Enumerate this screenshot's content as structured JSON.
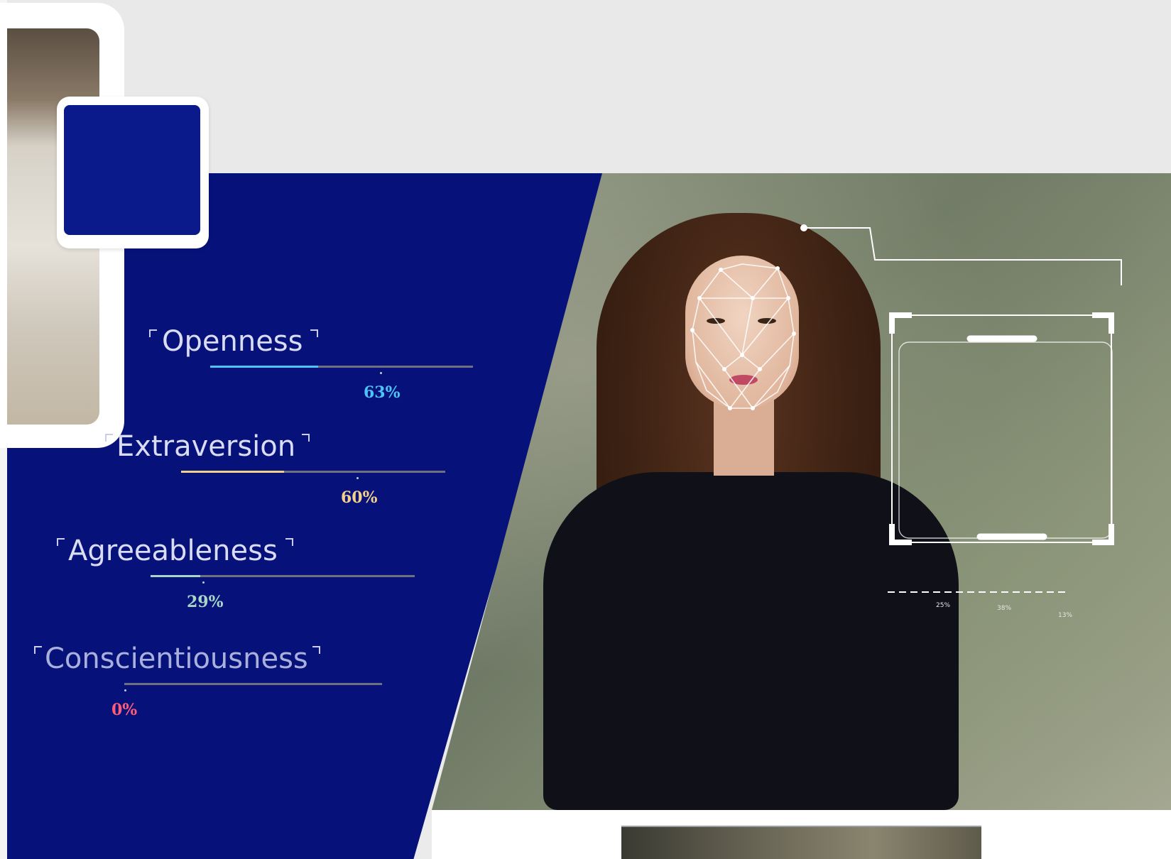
{
  "traits": [
    {
      "name": "Openness",
      "percent_label": "63%",
      "value": 0.63,
      "color": "#4fc3f7"
    },
    {
      "name": "Extraversion",
      "percent_label": "60%",
      "value": 0.6,
      "color": "#f2d089"
    },
    {
      "name": "Agreeableness",
      "percent_label": "29%",
      "value": 0.29,
      "color": "#a9d6c4"
    },
    {
      "name": "Conscientiousness",
      "percent_label": "0%",
      "value": 0.0,
      "color": "#ff5d76"
    }
  ],
  "hud_small_labels": [
    "25%",
    "38%",
    "13%"
  ],
  "colors": {
    "panel_blue": "#06127a",
    "page_bg": "#e9e9e9"
  },
  "icons": {
    "profile_head": "face-scan-head-icon"
  }
}
